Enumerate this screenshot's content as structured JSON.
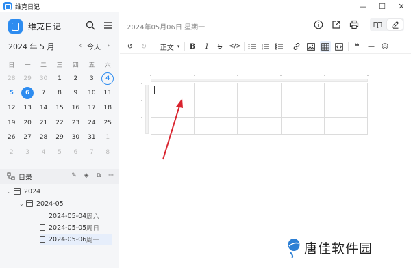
{
  "window": {
    "title": "维克日记",
    "min": "—",
    "max": "☐",
    "close": "✕"
  },
  "sidebar": {
    "app_name": "维克日记",
    "calendar": {
      "header": "2024 年 5 月",
      "prev": "‹",
      "today_label": "今天",
      "next": "›",
      "weekdays": [
        "日",
        "一",
        "二",
        "三",
        "四",
        "五",
        "六"
      ],
      "days": [
        {
          "d": "28",
          "t": "other"
        },
        {
          "d": "29",
          "t": "other"
        },
        {
          "d": "30",
          "t": "other"
        },
        {
          "d": "1",
          "t": ""
        },
        {
          "d": "2",
          "t": ""
        },
        {
          "d": "3",
          "t": ""
        },
        {
          "d": "4",
          "t": "today"
        },
        {
          "d": "5",
          "t": "blue"
        },
        {
          "d": "6",
          "t": "selected"
        },
        {
          "d": "7",
          "t": ""
        },
        {
          "d": "8",
          "t": ""
        },
        {
          "d": "9",
          "t": ""
        },
        {
          "d": "10",
          "t": ""
        },
        {
          "d": "11",
          "t": ""
        },
        {
          "d": "12",
          "t": ""
        },
        {
          "d": "13",
          "t": ""
        },
        {
          "d": "14",
          "t": ""
        },
        {
          "d": "15",
          "t": ""
        },
        {
          "d": "16",
          "t": ""
        },
        {
          "d": "17",
          "t": ""
        },
        {
          "d": "18",
          "t": ""
        },
        {
          "d": "19",
          "t": ""
        },
        {
          "d": "20",
          "t": ""
        },
        {
          "d": "21",
          "t": ""
        },
        {
          "d": "22",
          "t": ""
        },
        {
          "d": "23",
          "t": ""
        },
        {
          "d": "24",
          "t": ""
        },
        {
          "d": "25",
          "t": ""
        },
        {
          "d": "26",
          "t": ""
        },
        {
          "d": "27",
          "t": ""
        },
        {
          "d": "28",
          "t": ""
        },
        {
          "d": "29",
          "t": ""
        },
        {
          "d": "30",
          "t": ""
        },
        {
          "d": "31",
          "t": ""
        },
        {
          "d": "1",
          "t": "other"
        },
        {
          "d": "2",
          "t": "other"
        },
        {
          "d": "3",
          "t": "other"
        },
        {
          "d": "4",
          "t": "other"
        },
        {
          "d": "5",
          "t": "other"
        },
        {
          "d": "6",
          "t": "other"
        },
        {
          "d": "7",
          "t": "other"
        },
        {
          "d": "8",
          "t": "other"
        }
      ]
    },
    "toc": {
      "label": "目录",
      "year": "2024",
      "month": "2024-05",
      "entries": [
        {
          "date": "2024-05-04",
          "weekday": "周六"
        },
        {
          "date": "2024-05-05",
          "weekday": "周日"
        },
        {
          "date": "2024-05-06",
          "weekday": "周一"
        }
      ]
    }
  },
  "main": {
    "date_title": "2024年05月06日 星期一",
    "toolbar": {
      "paragraph": "正文"
    }
  },
  "watermark": {
    "text": "唐佳软件园"
  },
  "colors": {
    "accent": "#2d8cf0",
    "arrow": "#d9232e"
  }
}
